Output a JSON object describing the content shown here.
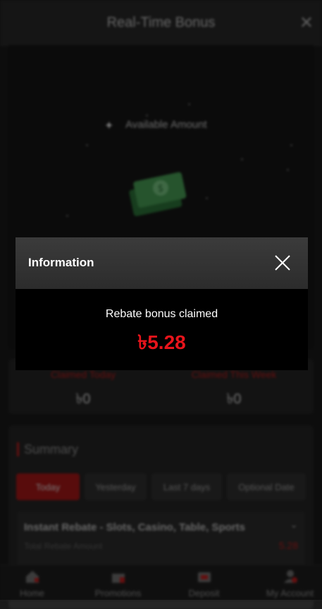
{
  "header": {
    "title": "Real-Time Bonus",
    "close_glyph": "✕"
  },
  "hero": {
    "available_label": "Available Amount",
    "sparkle_icon": "sparkle-icon",
    "money_icon": "money-stack-icon"
  },
  "stats": {
    "today_label": "Claimed Today",
    "today_value": "৳0",
    "week_label": "Claimed This Week",
    "week_value": "৳0"
  },
  "summary": {
    "title": "Summary",
    "tabs": [
      {
        "label": "Today",
        "active": true
      },
      {
        "label": "Yesterday",
        "active": false
      },
      {
        "label": "Last 7 days",
        "active": false
      },
      {
        "label": "Optional Date",
        "active": false
      }
    ],
    "rebate": {
      "title": "Instant Rebate - Slots, Casino, Table, Sports",
      "sub_label": "Total Rebate Amount",
      "value": "5.28"
    }
  },
  "bottom_nav": [
    {
      "label": "Home",
      "icon": "home-icon"
    },
    {
      "label": "Promotions",
      "icon": "gift-icon"
    },
    {
      "label": "Deposit",
      "icon": "wallet-icon"
    },
    {
      "label": "My Account",
      "icon": "user-icon"
    }
  ],
  "modal": {
    "title": "Information",
    "message": "Rebate bonus claimed",
    "amount": "৳5.28"
  },
  "colors": {
    "accent_red": "#e8141b",
    "tab_active": "#b01818"
  }
}
